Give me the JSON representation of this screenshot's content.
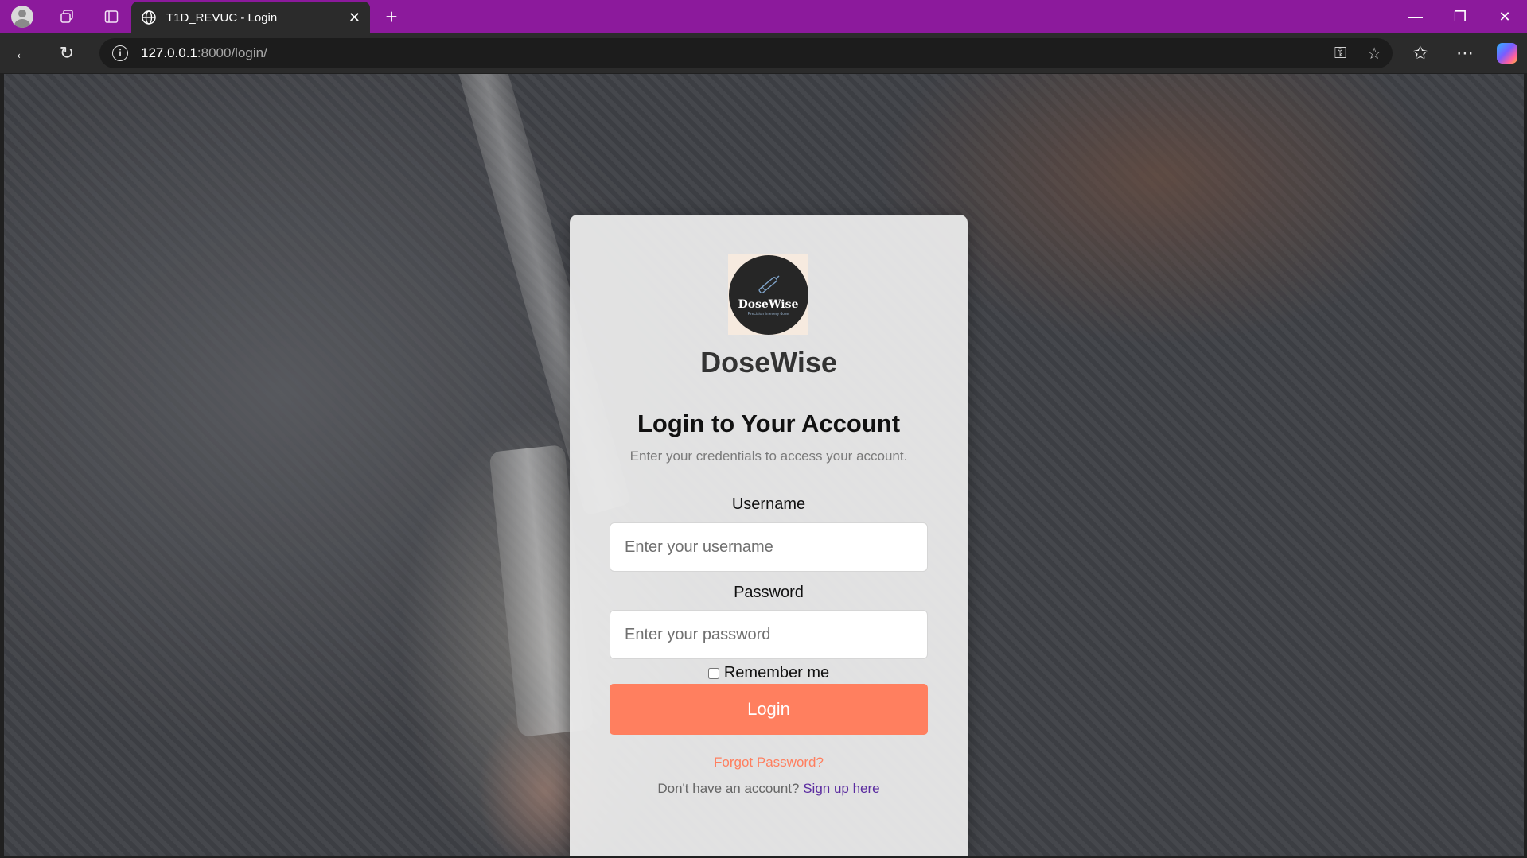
{
  "browser": {
    "tab_title": "T1D_REVUC - Login",
    "url_host": "127.0.0.1",
    "url_path": ":8000/login/",
    "accent": "#8c1a9c"
  },
  "logo": {
    "name": "DoseWise",
    "tagline": "Precision in every dose"
  },
  "login": {
    "brand": "DoseWise",
    "heading": "Login to Your Account",
    "subheading": "Enter your credentials to access your account.",
    "username_label": "Username",
    "username_placeholder": "Enter your username",
    "password_label": "Password",
    "password_placeholder": "Enter your password",
    "remember_label": "Remember me",
    "button_label": "Login",
    "forgot_label": "Forgot Password?",
    "signup_prompt": "Don't have an account?",
    "signup_link": "Sign up here",
    "button_color": "#ff7f5f"
  }
}
